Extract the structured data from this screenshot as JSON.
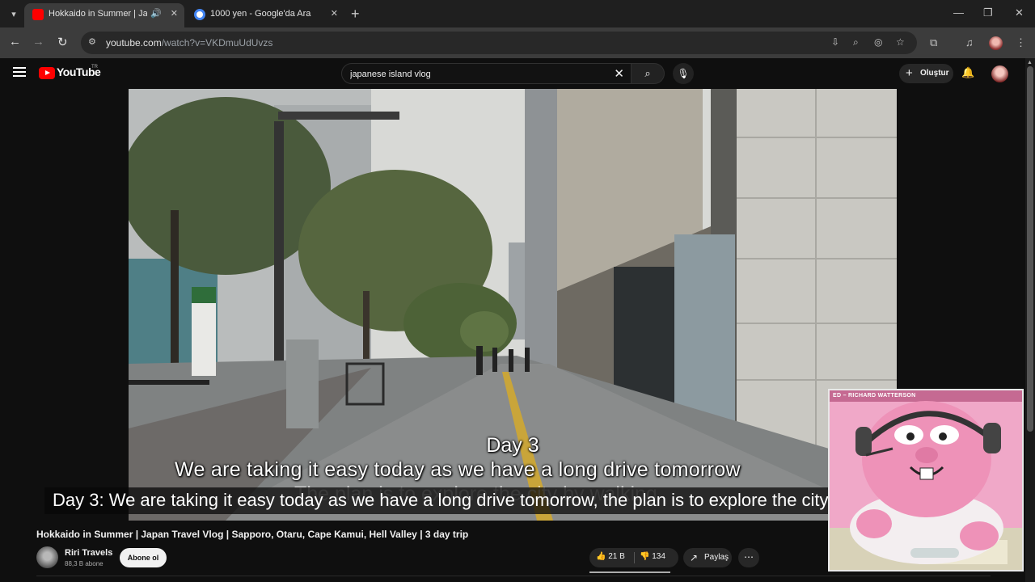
{
  "browser": {
    "tabs": [
      {
        "title": "Hokkaido in Summer | Japan Travel Vlog",
        "active": true,
        "favicon_color": "#ff0000"
      },
      {
        "title": "1000 yen - Google'da Ara",
        "active": false,
        "favicon_color": "#4285f4"
      }
    ],
    "url_host": "youtube.com",
    "url_rest": "/watch?v=VKDmuUdUvzs"
  },
  "youtube": {
    "logo_text": "YouTube",
    "country_code": "TR",
    "search_query": "japanese island vlog",
    "create_label": "Oluştur"
  },
  "video": {
    "burned_day": "Day 3",
    "burned_line": "We are taking it easy today as we have a long drive tomorrow",
    "burned_faded": "The plan is to explore the city by walking",
    "closed_caption": "Day 3: We are taking it easy today as we have a long drive tomorrow, the plan is to explore the city by walking",
    "title": "Hokkaido in Summer | Japan Travel Vlog | Sapporo, Otaru, Cape Kamui, Hell Valley | 3 day trip"
  },
  "channel": {
    "name": "Riri Travels",
    "subscribers": "88,3 B abone",
    "subscribe_label": "Abone ol"
  },
  "actions": {
    "likes": "21 B",
    "dislikes": "134",
    "share_label": "Paylaş"
  },
  "pip": {
    "label": "ED – RICHARD WATTERSON"
  },
  "colors": {
    "youtube_red": "#ff0000",
    "background": "#0f0f0f",
    "pip_pink": "#f0a8c8"
  }
}
